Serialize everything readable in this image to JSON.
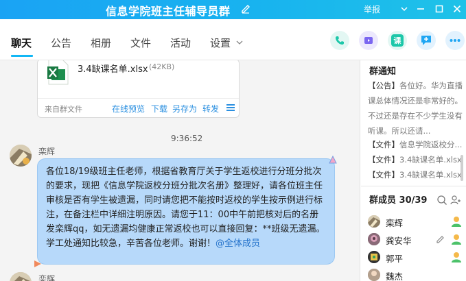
{
  "window": {
    "title": "信息学院班主任辅导员群",
    "report_label": "举报"
  },
  "tabs": [
    {
      "label": "聊天",
      "active": true
    },
    {
      "label": "公告"
    },
    {
      "label": "相册"
    },
    {
      "label": "文件"
    },
    {
      "label": "活动"
    },
    {
      "label": "设置"
    }
  ],
  "toolbar": {
    "class_label": "课",
    "colors": {
      "phone": "#1cc7a9",
      "video": "#7b66f0",
      "class": "#1cc7a9",
      "comment": "#20a6f3",
      "more": "#20a6f3"
    }
  },
  "file_message": {
    "name": "3.4缺课名单.xlsx",
    "size": "(42KB)",
    "source": "来自群文件",
    "actions": [
      "在线预览",
      "下载",
      "另存为",
      "转发"
    ]
  },
  "timestamp": "9:36:52",
  "message": {
    "sender": "栾辉",
    "text": "各位18/19级班主任老师，根据省教育厅关于学生返校进行分班分批次的要求，现把《信息学院返校分班分批次名册》整理好，请各位班主任审核是否有学生被遗漏，同时请您把不能按时返校的学生按示例进行标注，在备注栏中详细注明原因。请您于11：00中午前把核对后的名册发栾辉qq，如无遗漏均健康正常返校也可以直接回复：**班级无遗漏。学工处通知比较急，辛苦各位老师。谢谢！",
    "mention": "@全体成员"
  },
  "next_sender": "栾辉",
  "side_panel": {
    "notice_title": "群通知",
    "notice_tag": "【公告】",
    "notice_text": "各位好。华为直播课总体情况还是非常好的。不过还是存在不少学生没有听课。所以还请...",
    "file_tag": "【文件】",
    "files": [
      "信息学院返校分...",
      "3.4缺课名单.xlsx",
      "3.4缺课名单.xlsx"
    ],
    "members_title": "群成员 30/39",
    "members": [
      {
        "name": "栾辉",
        "role": "owner"
      },
      {
        "name": "龚安华",
        "role": "admin"
      },
      {
        "name": "郭平",
        "role": "admin"
      },
      {
        "name": "魏杰",
        "role": "member"
      }
    ]
  }
}
